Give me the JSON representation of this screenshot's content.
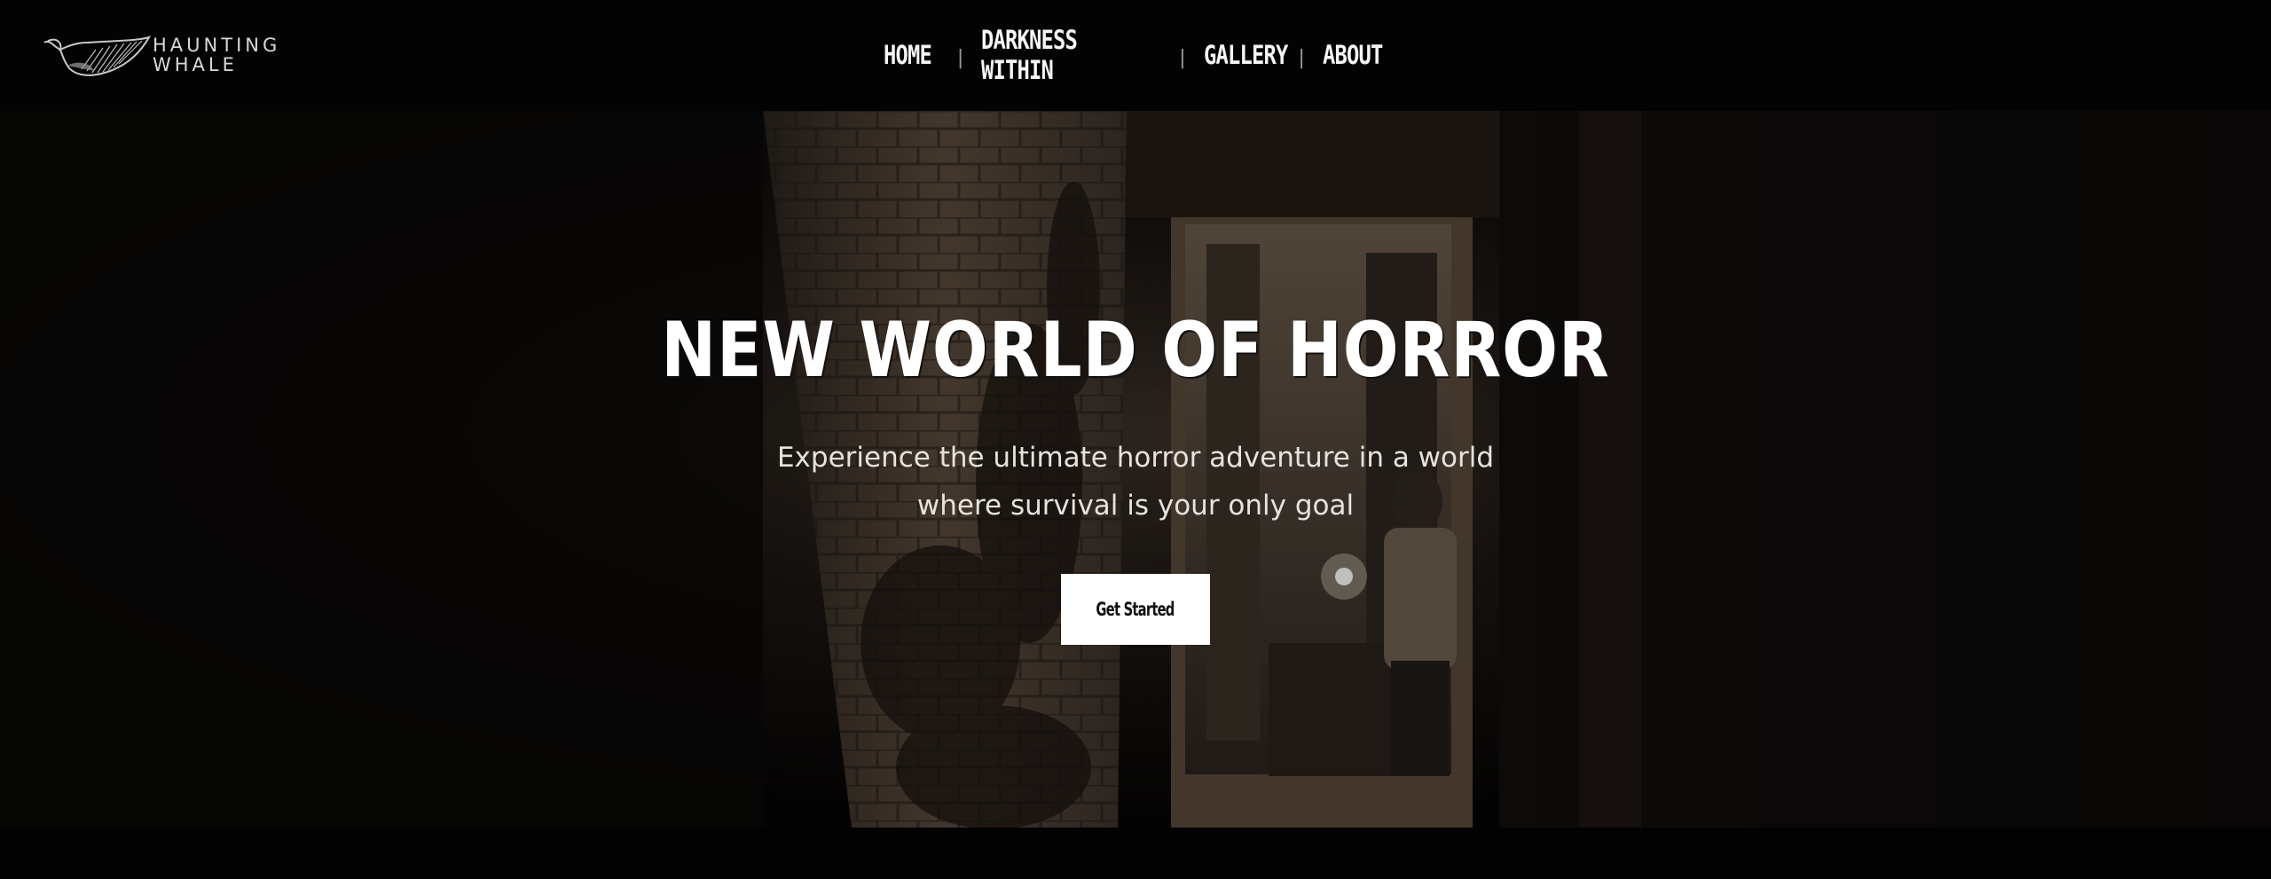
{
  "brand": {
    "name_line1": "HAUNTING",
    "name_line2": "WHALE",
    "logo_icon": "whale-icon"
  },
  "nav": {
    "items": [
      {
        "label": "HOME"
      },
      {
        "label": "DARKNESS WITHIN"
      },
      {
        "label": "GALLERY"
      },
      {
        "label": "ABOUT"
      }
    ],
    "separator": "|"
  },
  "hero": {
    "title": "NEW WORLD OF HORROR",
    "subtitle": "Experience the ultimate horror adventure in a world where survival is your only goal",
    "cta_label": "Get Started"
  },
  "colors": {
    "background": "#030303",
    "text": "#ffffff",
    "button_bg": "#ffffff",
    "button_text": "#111111"
  }
}
